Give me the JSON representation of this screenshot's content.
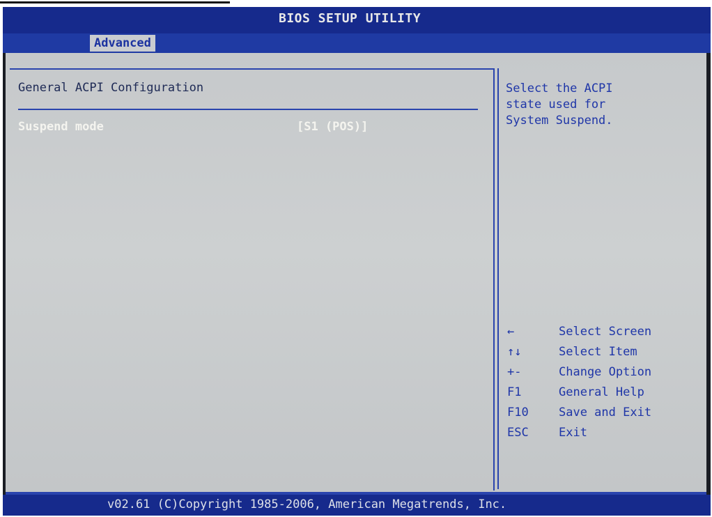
{
  "window": {
    "title": "BIOS SETUP UTILITY"
  },
  "tabs": [
    {
      "label": "Advanced",
      "selected": true
    }
  ],
  "main": {
    "section_title": "General ACPI Configuration",
    "options": [
      {
        "label": "Suspend mode",
        "value": "[S1 (POS)]",
        "selected": true
      }
    ]
  },
  "help": {
    "text": "Select the ACPI\nstate used for\nSystem Suspend.",
    "keys": [
      {
        "key": "←",
        "action": "Select Screen"
      },
      {
        "key": "↑↓",
        "action": "Select Item"
      },
      {
        "key": "+-",
        "action": "Change Option"
      },
      {
        "key": "F1",
        "action": "General Help"
      },
      {
        "key": "F10",
        "action": "Save and Exit"
      },
      {
        "key": "ESC",
        "action": "Exit"
      }
    ]
  },
  "footer": {
    "text": "v02.61 (C)Copyright 1985-2006, American Megatrends, Inc."
  },
  "colors": {
    "title_bar": "#162a8c",
    "background": "#c8cbcc",
    "help_text": "#1f36a8",
    "selected_option": "#f4f4ef"
  }
}
